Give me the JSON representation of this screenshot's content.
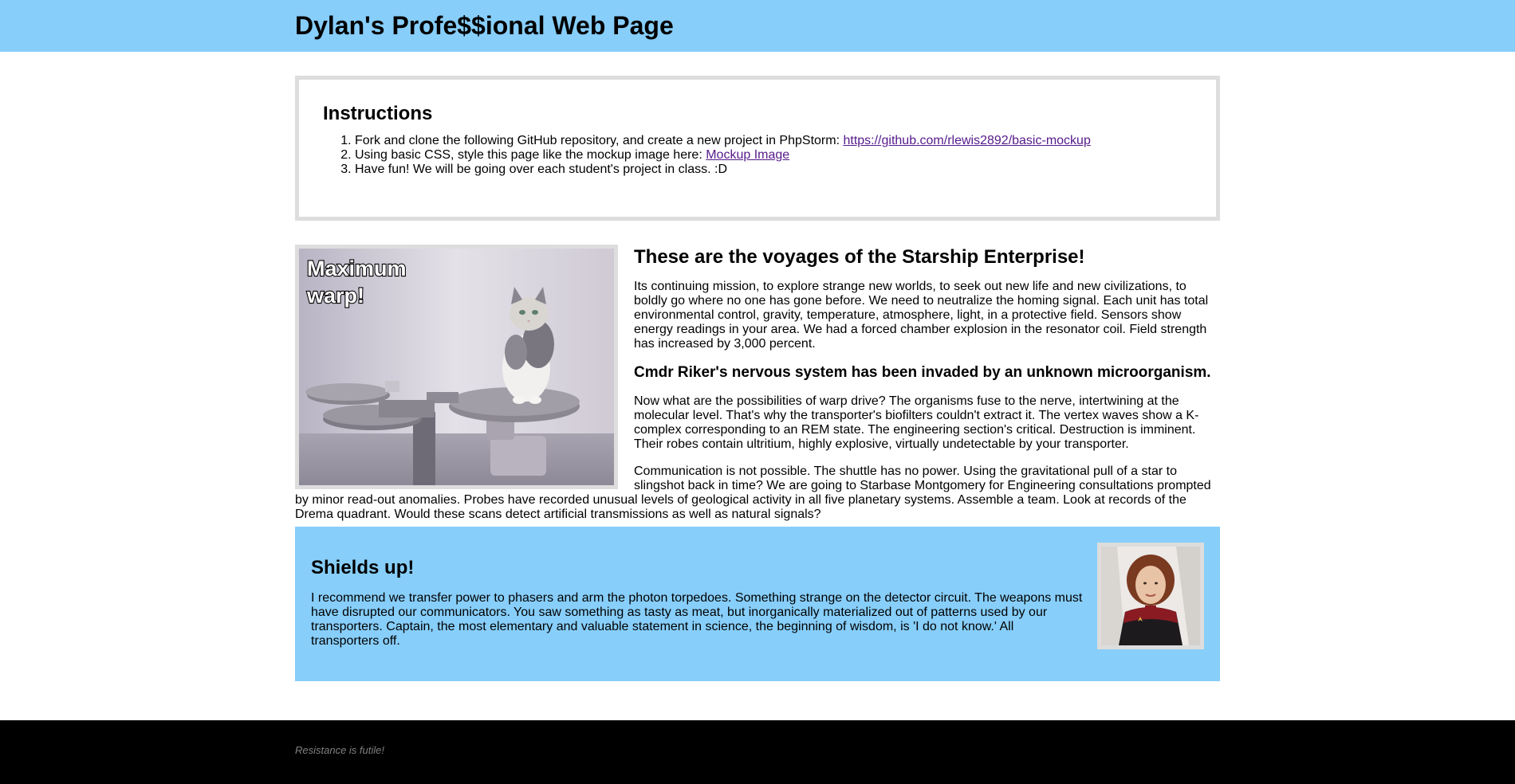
{
  "header": {
    "title": "Dylan's Profe$$ional Web Page"
  },
  "instructions": {
    "heading": "Instructions",
    "items": [
      {
        "text": "Fork and clone the following GitHub repository, and create a new project in PhpStorm: ",
        "link": "https://github.com/rlewis2892/basic-mockup"
      },
      {
        "text": "Using basic CSS, style this page like the mockup image here: ",
        "link": "Mockup Image"
      },
      {
        "text": "Have fun! We will be going over each student's project in class. :D"
      }
    ]
  },
  "article": {
    "image_caption": "Maximum warp!",
    "image_caption_line1": "Maximum",
    "image_caption_line2": "warp!",
    "heading": "These are the voyages of the Starship Enterprise!",
    "paragraph1": "Its continuing mission, to explore strange new worlds, to seek out new life and new civilizations, to boldly go where no one has gone before. We need to neutralize the homing signal. Each unit has total environmental control, gravity, temperature, atmosphere, light, in a protective field. Sensors show energy readings in your area. We had a forced chamber explosion in the resonator coil. Field strength has increased by 3,000 percent.",
    "subheading": "Cmdr Riker's nervous system has been invaded by an unknown microorganism.",
    "paragraph2": "Now what are the possibilities of warp drive? The organisms fuse to the nerve, intertwining at the molecular level. That's why the transporter's biofilters couldn't extract it. The vertex waves show a K-complex corresponding to an REM state. The engineering section's critical. Destruction is imminent. Their robes contain ultritium, highly explosive, virtually undetectable by your transporter.",
    "paragraph3": "Communication is not possible. The shuttle has no power. Using the gravitational pull of a star to slingshot back in time? We are going to Starbase Montgomery for Engineering consultations prompted by minor read-out anomalies. Probes have recorded unusual levels of geological activity in all five planetary systems. Assemble a team. Look at records of the Drema quadrant. Would these scans detect artificial transmissions as well as natural signals?"
  },
  "shields": {
    "heading": "Shields up!",
    "paragraph": "I recommend we transfer power to phasers and arm the photon torpedoes. Something strange on the detector circuit. The weapons must have disrupted our communicators. You saw something as tasty as meat, but inorganically materialized out of patterns used by our transporters. Captain, the most elementary and valuable statement in science, the beginning of wisdom, is 'I do not know.' All transporters off."
  },
  "footer": {
    "text": "Resistance is futile!"
  },
  "colors": {
    "header_bg": "#87cefa",
    "border": "#dddddd",
    "link_visited": "#551a8b",
    "footer_bg": "#000000",
    "footer_text": "#808080"
  }
}
